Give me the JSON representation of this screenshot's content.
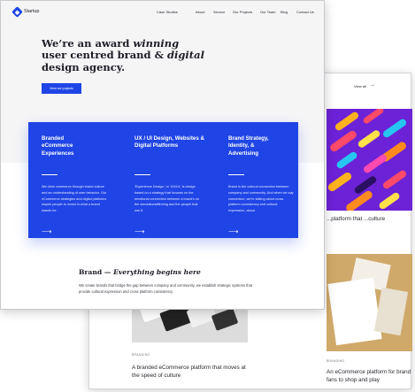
{
  "back_page": {
    "view_all": "View all",
    "view_all_arrow": "→",
    "cards": [
      {
        "tag": "",
        "title": "...platform that ...culture"
      },
      {
        "tag": "BRANDING",
        "title": "An eCommerce platform for brand fans to shop and play"
      },
      {
        "tag": "BRANDING",
        "title": "A branded eCommerce platform that moves at the speed of culture"
      }
    ]
  },
  "header": {
    "logo_text": "Startup",
    "nav": [
      "Case Studies",
      "About",
      "Service",
      "Our Projects",
      "Our Team",
      "Blog",
      "Contact Us"
    ]
  },
  "hero": {
    "title_line1": "We’re an award ",
    "title_em1": "winning",
    "title_line2a": "user centred brand & ",
    "title_em2": "digital",
    "title_line3": "design agency.",
    "cta_label": "View our projects"
  },
  "services": [
    {
      "title": "Branded eCommerce Experiences",
      "description": "We drive commerce through brand culture and an understanding of user behavior. Our eCommerce strategies and digital platforms inspire people to invest in what a brand stands for.",
      "arrow": "⟶"
    },
    {
      "title": "UX / UI Design, Websites & Digital Platforms",
      "description": "‘Experience Design,’ or ‘UX/UI,’ is design based on a strategy that focuses on the emotional connection between a brand’s on the simulationaffirming and the people that use it.",
      "arrow": "⟶"
    },
    {
      "title": "Brand Strategy, Identity, & Advertising",
      "description": "Brand is the cultural connection between company and community. And when we say connection, we’re talking about cross platform consistency and cultural expression, about",
      "arrow": "⟶"
    }
  ],
  "brand_section": {
    "title_plain": "Brand — ",
    "title_em": "Everything begins here",
    "description": "We create brands that bridge the gap between company and community, we establish strategic systems that provide cultural expression and cross platform consistency."
  },
  "colors": {
    "accent": "#1f45e6",
    "hero_bg": "#f5f5f6",
    "purple_art": "#6c22d6",
    "brown_art": "#cfa96a"
  }
}
